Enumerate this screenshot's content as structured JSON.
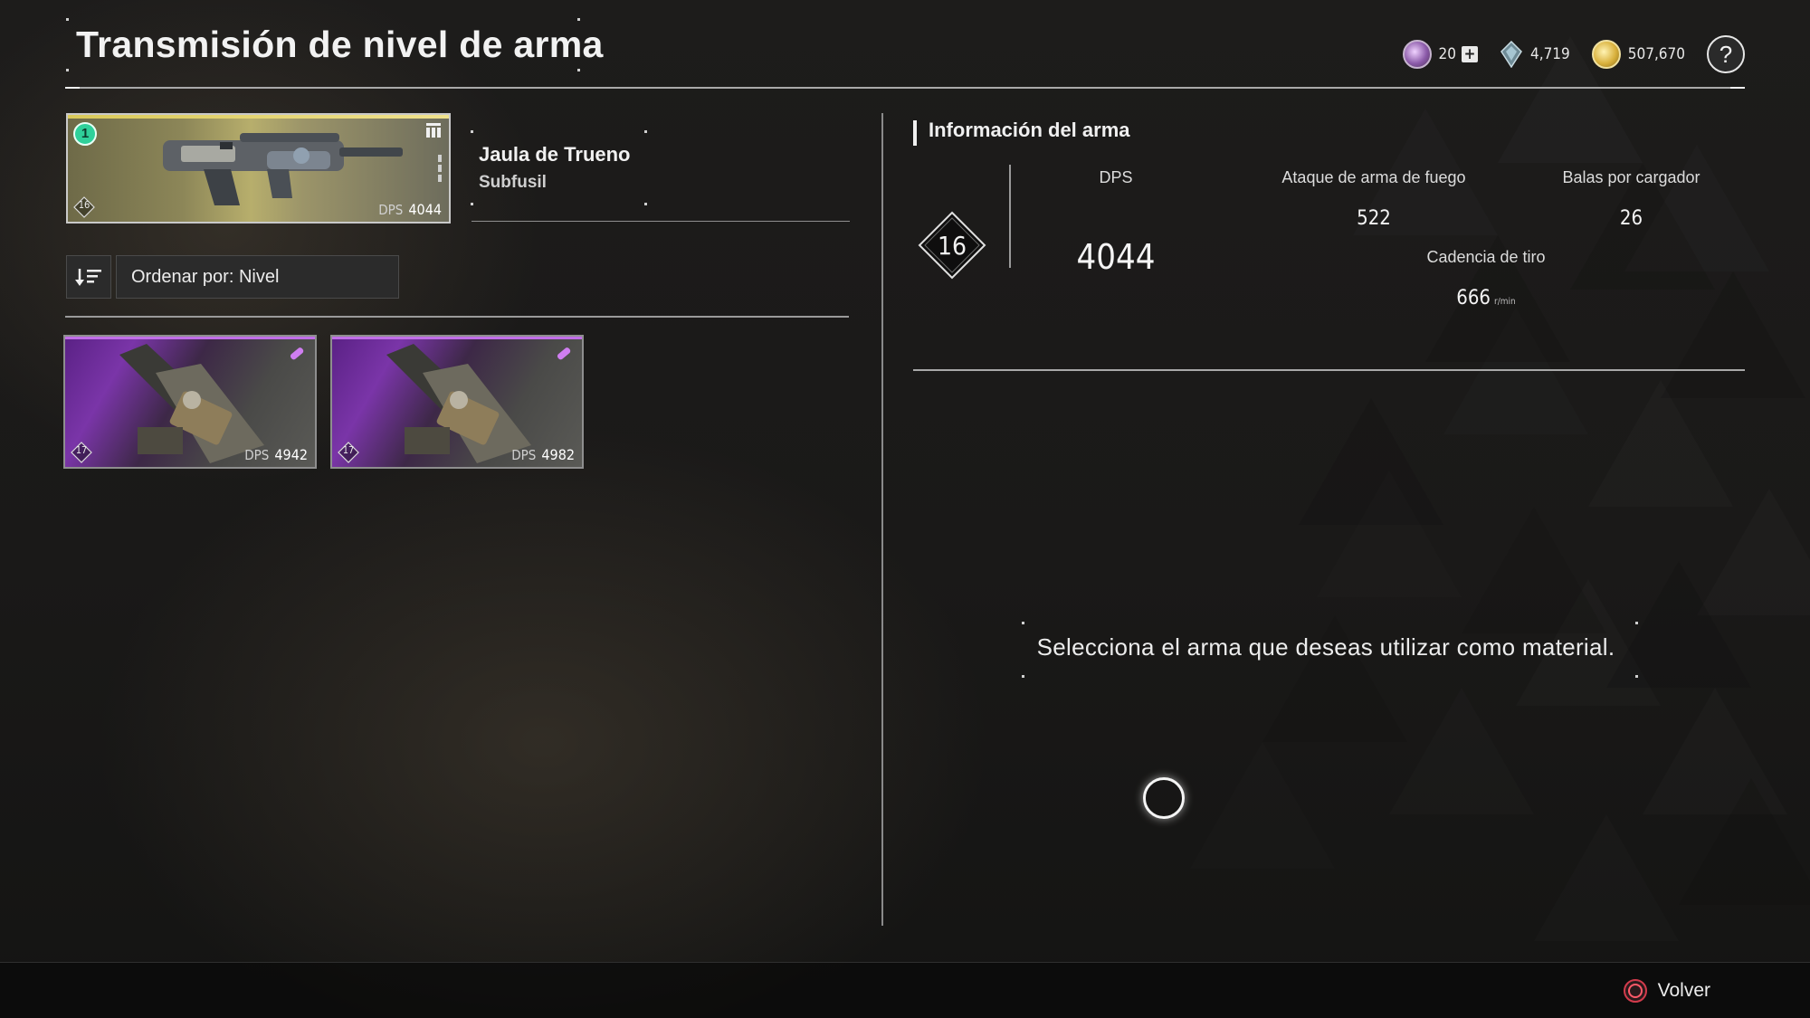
{
  "header": {
    "title": "Transmisión de nivel de arma",
    "currencies": [
      {
        "icon": "purple-orb-icon",
        "value": "20",
        "has_plus": true
      },
      {
        "icon": "crystal-icon",
        "value": "4,719"
      },
      {
        "icon": "gold-coin-icon",
        "value": "507,670"
      }
    ],
    "help_label": "?"
  },
  "selected_weapon": {
    "equipped_badge": "1",
    "level": "16",
    "dps_label": "DPS",
    "dps": "4044",
    "name": "Jaula de Trueno",
    "type": "Subfusil"
  },
  "sort": {
    "label": "Ordenar por: Nivel"
  },
  "materials": [
    {
      "level": "17",
      "dps_label": "DPS",
      "dps": "4942"
    },
    {
      "level": "17",
      "dps_label": "DPS",
      "dps": "4982"
    }
  ],
  "info": {
    "title": "Información del arma",
    "level": "16",
    "dps_label": "DPS",
    "dps_value": "4044",
    "attack_label": "Ataque de arma de fuego",
    "attack_value": "522",
    "mag_label": "Balas por cargador",
    "mag_value": "26",
    "rate_label": "Cadencia de tiro",
    "rate_value": "666",
    "rate_unit": "r/min"
  },
  "prompt": "Selecciona el arma que deseas utilizar como material.",
  "footer": {
    "back_label": "Volver"
  },
  "colors": {
    "accent_equipped": "#2fd09a",
    "rarity_gold": "#d9c95a",
    "rarity_purple": "#c16de8",
    "back_button": "#d23b4c"
  }
}
